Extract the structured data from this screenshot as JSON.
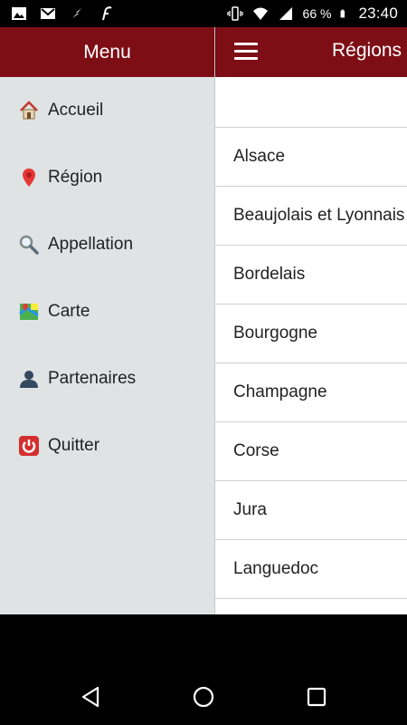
{
  "status_bar": {
    "battery": "66 %",
    "time": "23:40",
    "icons": [
      "image-icon",
      "gmail-icon",
      "flash-icon",
      "tool-icon",
      "vibrate-icon",
      "wifi-icon",
      "signal-icon",
      "battery-icon"
    ]
  },
  "drawer": {
    "title": "Menu",
    "items": [
      {
        "label": "Accueil",
        "icon": "home-icon"
      },
      {
        "label": "Région",
        "icon": "map-pin-icon"
      },
      {
        "label": "Appellation",
        "icon": "search-icon"
      },
      {
        "label": "Carte",
        "icon": "map-icon"
      },
      {
        "label": "Partenaires",
        "icon": "person-icon"
      },
      {
        "label": "Quitter",
        "icon": "power-icon"
      }
    ]
  },
  "main": {
    "title": "Régions",
    "regions": [
      "Alsace",
      "Beaujolais et Lyonnais",
      "Bordelais",
      "Bourgogne",
      "Champagne",
      "Corse",
      "Jura",
      "Languedoc"
    ]
  },
  "colors": {
    "header": "#7e0e16",
    "drawer_bg": "#dfe3e4"
  },
  "nav_bar": {
    "buttons": [
      "back-icon",
      "home-circle-icon",
      "recents-icon"
    ]
  }
}
